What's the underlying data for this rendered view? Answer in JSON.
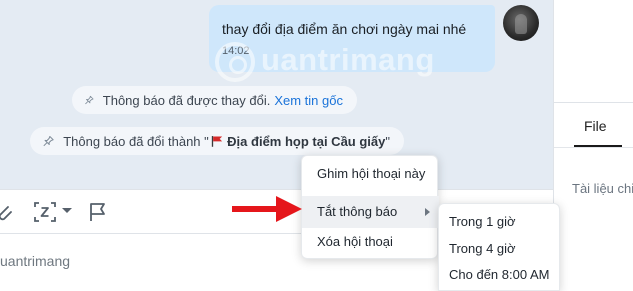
{
  "chat": {
    "message": {
      "text": "thay đổi địa điểm ăn chơi ngày mai nhé",
      "time": "14:02"
    },
    "system_notices": [
      {
        "text": "Thông báo đã được thay đổi.",
        "link": "Xem tin gốc"
      },
      {
        "prefix": "Thông báo đã đổi thành \"",
        "title": "Địa điểm họp tại Cầu giấy",
        "suffix": "\""
      }
    ]
  },
  "watermark": {
    "text": "uantrimang"
  },
  "input": {
    "placeholder": "uantrimang"
  },
  "toolbar": {
    "icons": [
      "attach-icon",
      "screenshot-icon",
      "chevron-down-icon",
      "flag-icon"
    ]
  },
  "context_menu": {
    "items": [
      {
        "label": "Ghim hội thoại này"
      },
      {
        "label": "Tắt thông báo",
        "has_submenu": true
      },
      {
        "label": "Xóa hội thoại"
      }
    ]
  },
  "submenu": {
    "items": [
      {
        "label": "Trong 1 giờ"
      },
      {
        "label": "Trong 4 giờ"
      },
      {
        "label": "Cho đến 8:00 AM"
      }
    ]
  },
  "right_panel": {
    "tab": "File",
    "section_label": "Tài liệu chia"
  },
  "colors": {
    "chat_bg": "#e4ebf3",
    "bubble": "#cfe7fb",
    "link": "#1a73d9",
    "arrow": "#e5161b",
    "flag": "#d42a2a"
  }
}
